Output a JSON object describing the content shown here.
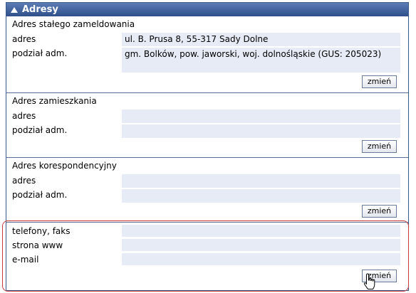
{
  "panel": {
    "title": "Adresy"
  },
  "sections": [
    {
      "title": "Adres stałego zameldowania",
      "adres_label": "adres",
      "adres_value": "ul. B. Prusa 8, 55-317 Sady Dolne",
      "podzial_label": "podział adm.",
      "podzial_value": "gm. Bolków, pow. jaworski, woj. dolnośląskie (GUS: 205023)",
      "button": "zmień"
    },
    {
      "title": "Adres zamieszkania",
      "adres_label": "adres",
      "adres_value": "",
      "podzial_label": "podział adm.",
      "podzial_value": "",
      "button": "zmień"
    },
    {
      "title": "Adres korespondencyjny",
      "adres_label": "adres",
      "adres_value": "",
      "podzial_label": "podział adm.",
      "podzial_value": "",
      "button": "zmień"
    }
  ],
  "contact": {
    "phone_label": "telefony, faks",
    "phone_value": "",
    "www_label": "strona www",
    "www_value": "",
    "email_label": "e-mail",
    "email_value": "",
    "button": "zmień"
  },
  "icons": {
    "collapse": "triangle-up-icon",
    "cursor": "hand-pointer-icon"
  }
}
